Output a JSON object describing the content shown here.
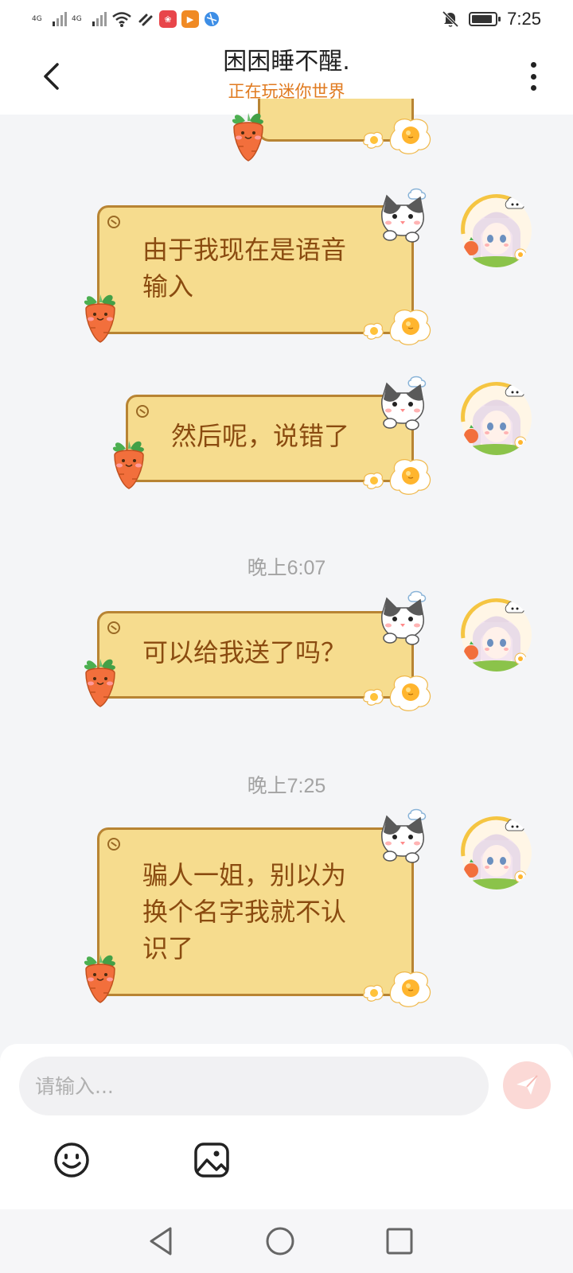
{
  "status_bar": {
    "sim1": "4G",
    "sim2": "4G",
    "time": "7:25",
    "battery_level": 0.9,
    "icons": [
      "sim-signal-icon",
      "wifi-icon",
      "link-icon",
      "app-icon",
      "video-app-icon",
      "browser-icon",
      "mute-bell-icon",
      "battery-icon"
    ]
  },
  "header": {
    "title": "困困睡不醒.",
    "subtitle": "正在玩迷你世界"
  },
  "messages": [
    {
      "text": "由于我现在是语音\n输入"
    },
    {
      "text": "然后呢，说错了"
    },
    {
      "timestamp": "晚上6:07"
    },
    {
      "text": "可以给我送了吗？"
    },
    {
      "timestamp": "晚上7:25"
    },
    {
      "text": "骗人一姐，别以为\n换个名字我就不认\n识了"
    }
  ],
  "input": {
    "placeholder": "请输入..."
  },
  "colors": {
    "bubble_fill": "#f6dc8e",
    "bubble_border": "#b88433",
    "bubble_text": "#8a4b10",
    "subtitle": "#e07a1f",
    "send_button": "#fbd9d6"
  }
}
